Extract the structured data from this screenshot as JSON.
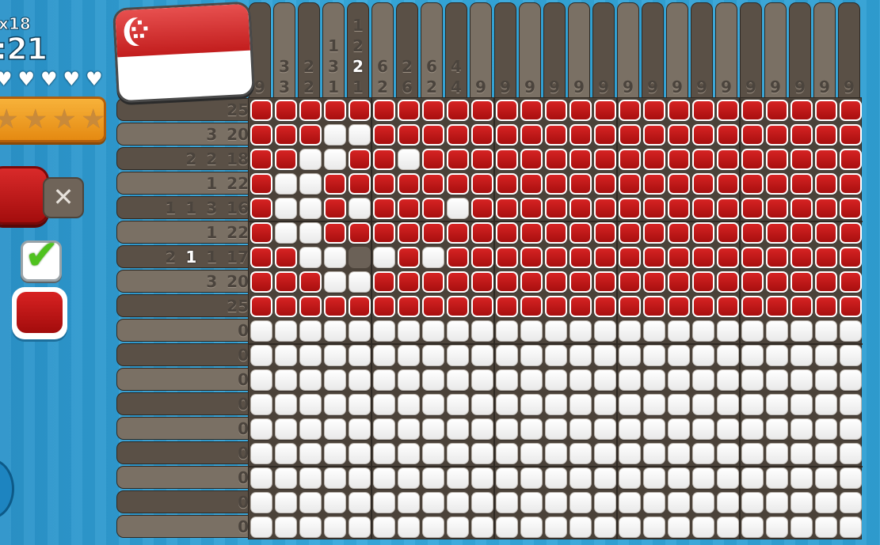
{
  "hud": {
    "grid_size": "x18",
    "timer": ":21",
    "hearts": 5,
    "stars": 4,
    "close_label": "✕",
    "check_label": "✔"
  },
  "colors": {
    "red": "#c81a1a",
    "white": "#ffffff",
    "panel": "#5a5046"
  },
  "puzzle": {
    "cols": 25,
    "rows": 18,
    "col_clues": [
      [
        "9"
      ],
      [
        "3",
        "3"
      ],
      [
        "2",
        "2"
      ],
      [
        "1",
        "3",
        "1"
      ],
      [
        "1",
        "2",
        "2",
        "1"
      ],
      [
        "6",
        "2"
      ],
      [
        "2",
        "6"
      ],
      [
        "6",
        "2"
      ],
      [
        "4",
        "4"
      ],
      [
        "9"
      ],
      [
        "9"
      ],
      [
        "9"
      ],
      [
        "9"
      ],
      [
        "9"
      ],
      [
        "9"
      ],
      [
        "9"
      ],
      [
        "9"
      ],
      [
        "9"
      ],
      [
        "9"
      ],
      [
        "9"
      ],
      [
        "9"
      ],
      [
        "9"
      ],
      [
        "9"
      ],
      [
        "9"
      ],
      [
        "9"
      ]
    ],
    "col_clue_highlight": {
      "4": 2
    },
    "row_clues": [
      [
        "25"
      ],
      [
        "3",
        "20"
      ],
      [
        "2",
        "2",
        "18"
      ],
      [
        "1",
        "22"
      ],
      [
        "1",
        "1",
        "3",
        "16"
      ],
      [
        "1",
        "22"
      ],
      [
        "2",
        "1",
        "1",
        "17"
      ],
      [
        "3",
        "20"
      ],
      [
        "25"
      ],
      [
        "0"
      ],
      [
        "0"
      ],
      [
        "0"
      ],
      [
        "0"
      ],
      [
        "0"
      ],
      [
        "0"
      ],
      [
        "0"
      ],
      [
        "0"
      ],
      [
        "0"
      ]
    ],
    "row_clue_highlight": {
      "6": 1
    },
    "grid": [
      "RRRRRRRRRRRRRRRRRRRRRRRRR",
      "RRRWWRRRRRRRRRRRRRRRRRRRR",
      "RRWWRRWRRRRRRRRRRRRRRRRRR",
      "RWWRRRRRRRRRRRRRRRRRRRRRR",
      "RWWRWRRRWRRRRRRRRRRRRRRRR",
      "RWWRRRRRRRRRRRRRRRRRRRRRR",
      "RRWWEWRWRRRRRRRRRRRRRRRRR",
      "RRRWWRRRRRRRRRRRRRRRRRRRR",
      "RRRRRRRRRRRRRRRRRRRRRRRRR",
      "WWWWWWWWWWWWWWWWWWWWWWWWW",
      "WWWWWWWWWWWWWWWWWWWWWWWWW",
      "WWWWWWWWWWWWWWWWWWWWWWWWW",
      "WWWWWWWWWWWWWWWWWWWWWWWWW",
      "WWWWWWWWWWWWWWWWWWWWWWWWW",
      "WWWWWWWWWWWWWWWWWWWWWWWWW",
      "WWWWWWWWWWWWWWWWWWWWWWWWW",
      "WWWWWWWWWWWWWWWWWWWWWWWWW",
      "WWWWWWWWWWWWWWWWWWWWWWWWW"
    ]
  }
}
